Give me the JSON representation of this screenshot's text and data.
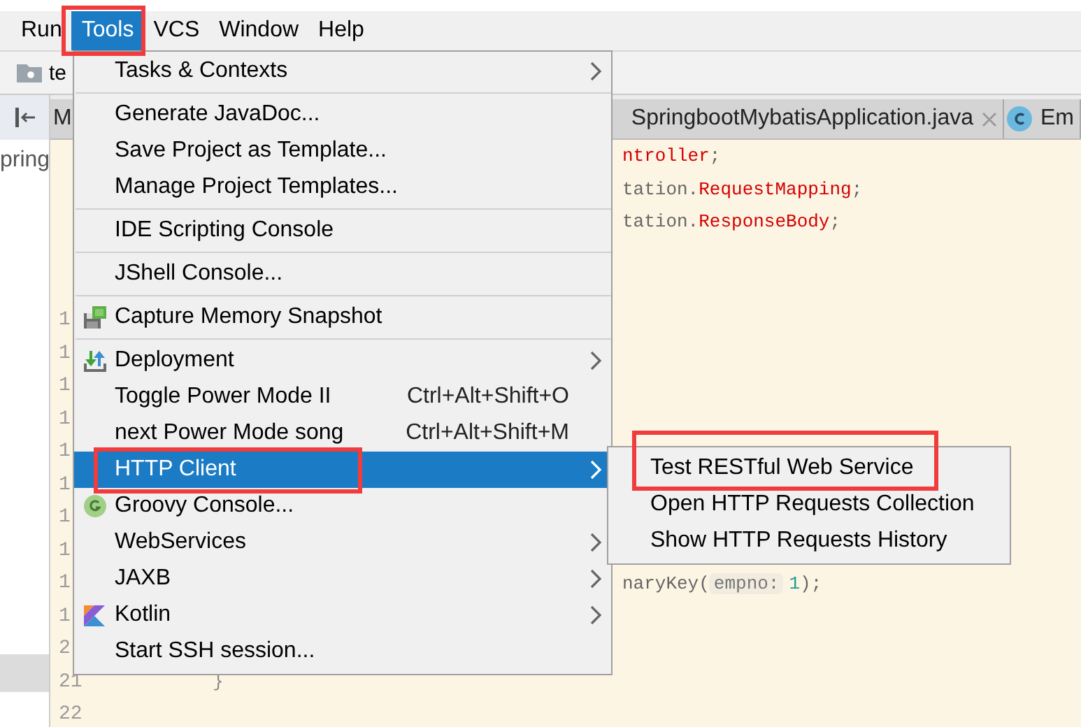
{
  "menu_bar": [
    {
      "label": "Run",
      "selected": false
    },
    {
      "label": "Tools",
      "selected": true
    },
    {
      "label": "VCS",
      "selected": false
    },
    {
      "label": "Window",
      "selected": false
    },
    {
      "label": "Help",
      "selected": false
    }
  ],
  "navigation_bar": {
    "crumb": "te"
  },
  "project_panel": {
    "item": "pring"
  },
  "editor_tabs": [
    {
      "label": "M",
      "closable": false
    },
    {
      "label": "SpringbootMybatisApplication.java",
      "closable": true
    },
    {
      "label": "Em",
      "closable": false
    }
  ],
  "editor": {
    "lines": [
      {
        "kind": "code",
        "parts": [
          {
            "text": "ntroller",
            "kind": "type"
          },
          {
            "text": ";",
            "kind": "plain"
          }
        ]
      },
      {
        "kind": "code",
        "parts": [
          {
            "text": "tation.",
            "kind": "plain"
          },
          {
            "text": "RequestMapping",
            "kind": "type"
          },
          {
            "text": ";",
            "kind": "plain"
          }
        ]
      },
      {
        "kind": "code",
        "parts": [
          {
            "text": "tation.",
            "kind": "plain"
          },
          {
            "text": "ResponseBody",
            "kind": "type"
          },
          {
            "text": ";",
            "kind": "plain"
          }
        ]
      },
      {
        "kind": "blank"
      },
      {
        "kind": "blank"
      },
      {
        "number": "1"
      },
      {
        "number": "1"
      },
      {
        "number": "1"
      },
      {
        "number": "1"
      },
      {
        "number": "1"
      },
      {
        "number": "1"
      },
      {
        "number": "1"
      },
      {
        "number": "1"
      },
      {
        "number": "1",
        "parts": [
          {
            "text": "naryKey(",
            "kind": "plain"
          },
          {
            "text": "empno:",
            "kind": "hint"
          },
          {
            "text": "1",
            "kind": "number"
          },
          {
            "text": ");",
            "kind": "plain"
          }
        ]
      },
      {
        "number": "1"
      },
      {
        "number": "2"
      },
      {
        "number": "21",
        "parts": [
          {
            "text": "}",
            "kind": "brace"
          }
        ]
      },
      {
        "number": "22"
      }
    ]
  },
  "tools_menu": [
    {
      "kind": "plain",
      "label": "Tasks & Contexts",
      "submenu": true,
      "selected": false
    },
    {
      "kind": "separator"
    },
    {
      "kind": "plain",
      "label": "Generate JavaDoc...",
      "submenu": false,
      "selected": false
    },
    {
      "kind": "plain",
      "label": "Save Project as Template...",
      "submenu": false,
      "selected": false
    },
    {
      "kind": "plain",
      "label": "Manage Project Templates...",
      "submenu": false,
      "selected": false
    },
    {
      "kind": "separator"
    },
    {
      "kind": "plain",
      "label": "IDE Scripting Console",
      "submenu": false,
      "selected": false
    },
    {
      "kind": "separator"
    },
    {
      "kind": "plain",
      "label": "JShell Console...",
      "submenu": false,
      "selected": false
    },
    {
      "kind": "separator"
    },
    {
      "kind": "memory",
      "label": "Capture Memory Snapshot",
      "submenu": false,
      "selected": false
    },
    {
      "kind": "separator"
    },
    {
      "kind": "deploy",
      "label": "Deployment",
      "submenu": true,
      "selected": false
    },
    {
      "kind": "plain",
      "label": "Toggle Power Mode II",
      "shortcut": "Ctrl+Alt+Shift+O",
      "submenu": false,
      "selected": false
    },
    {
      "kind": "plain",
      "label": "next Power Mode song",
      "shortcut": "Ctrl+Alt+Shift+M",
      "submenu": false,
      "selected": false
    },
    {
      "kind": "plain",
      "label": "HTTP Client",
      "submenu": true,
      "selected": true
    },
    {
      "kind": "groovy",
      "label": "Groovy Console...",
      "submenu": false,
      "selected": false
    },
    {
      "kind": "plain",
      "label": "WebServices",
      "submenu": true,
      "selected": false
    },
    {
      "kind": "plain",
      "label": "JAXB",
      "submenu": true,
      "selected": false
    },
    {
      "kind": "kotlin",
      "label": "Kotlin",
      "submenu": true,
      "selected": false
    },
    {
      "kind": "plain",
      "label": "Start SSH session...",
      "submenu": false,
      "selected": false
    }
  ],
  "http_client_submenu": [
    {
      "label": "Test RESTful Web Service"
    },
    {
      "label": "Open HTTP Requests Collection"
    },
    {
      "label": "Show HTTP Requests History"
    }
  ]
}
